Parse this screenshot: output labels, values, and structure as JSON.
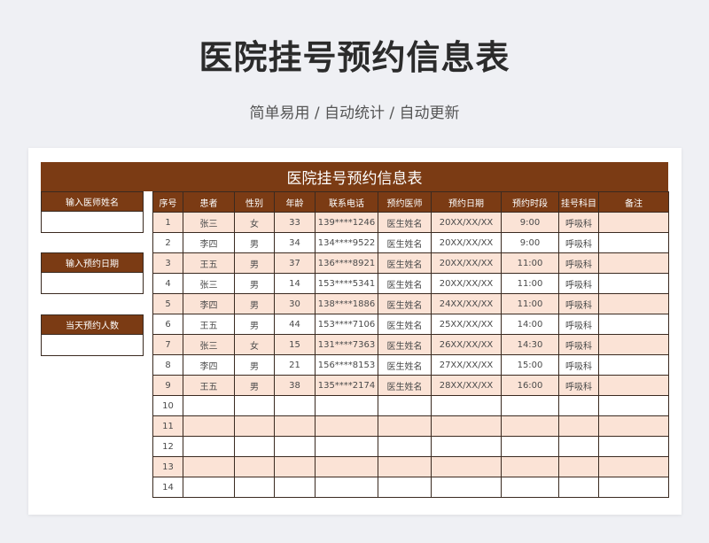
{
  "header": {
    "title": "医院挂号预约信息表",
    "subtitle": "简单易用 / 自动统计 / 自动更新"
  },
  "sheet": {
    "banner": "医院挂号预约信息表",
    "left_panel": {
      "doctor_name_label": "输入医师姓名",
      "doctor_name_value": "",
      "date_label": "输入预约日期",
      "date_value": "",
      "count_label": "当天预约人数",
      "count_value": ""
    },
    "columns": [
      "序号",
      "患者",
      "性别",
      "年龄",
      "联系电话",
      "预约医师",
      "预约日期",
      "预约时段",
      "挂号科目",
      "备注"
    ],
    "rows": [
      [
        "1",
        "张三",
        "女",
        "33",
        "139****1246",
        "医生姓名",
        "20XX/XX/XX",
        "9:00",
        "呼吸科",
        ""
      ],
      [
        "2",
        "李四",
        "男",
        "34",
        "134****9522",
        "医生姓名",
        "20XX/XX/XX",
        "9:00",
        "呼吸科",
        ""
      ],
      [
        "3",
        "王五",
        "男",
        "37",
        "136****8921",
        "医生姓名",
        "20XX/XX/XX",
        "11:00",
        "呼吸科",
        ""
      ],
      [
        "4",
        "张三",
        "男",
        "14",
        "153****5341",
        "医生姓名",
        "20XX/XX/XX",
        "11:00",
        "呼吸科",
        ""
      ],
      [
        "5",
        "李四",
        "男",
        "30",
        "138****1886",
        "医生姓名",
        "24XX/XX/XX",
        "11:00",
        "呼吸科",
        ""
      ],
      [
        "6",
        "王五",
        "男",
        "44",
        "153****7106",
        "医生姓名",
        "25XX/XX/XX",
        "14:00",
        "呼吸科",
        ""
      ],
      [
        "7",
        "张三",
        "女",
        "15",
        "131****7363",
        "医生姓名",
        "26XX/XX/XX",
        "14:30",
        "呼吸科",
        ""
      ],
      [
        "8",
        "李四",
        "男",
        "21",
        "156****8153",
        "医生姓名",
        "27XX/XX/XX",
        "15:00",
        "呼吸科",
        ""
      ],
      [
        "9",
        "王五",
        "男",
        "38",
        "135****2174",
        "医生姓名",
        "28XX/XX/XX",
        "16:00",
        "呼吸科",
        ""
      ],
      [
        "10",
        "",
        "",
        "",
        "",
        "",
        "",
        "",
        "",
        ""
      ],
      [
        "11",
        "",
        "",
        "",
        "",
        "",
        "",
        "",
        "",
        ""
      ],
      [
        "12",
        "",
        "",
        "",
        "",
        "",
        "",
        "",
        "",
        ""
      ],
      [
        "13",
        "",
        "",
        "",
        "",
        "",
        "",
        "",
        "",
        ""
      ],
      [
        "14",
        "",
        "",
        "",
        "",
        "",
        "",
        "",
        "",
        ""
      ]
    ]
  },
  "colors": {
    "header_brown": "#7b3b14",
    "row_tint": "#fbe3d6",
    "page_bg": "#eff0f4"
  }
}
